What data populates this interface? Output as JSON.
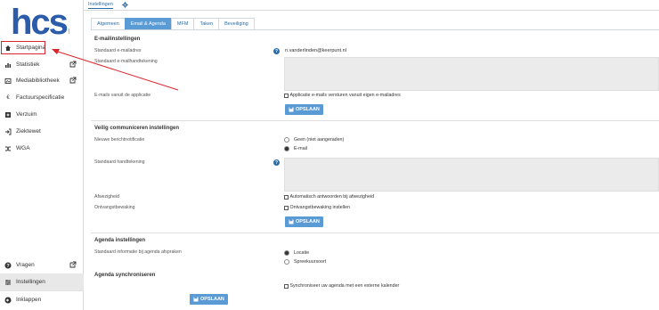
{
  "logo": {
    "text": "hcs."
  },
  "sidebar": {
    "items": [
      {
        "label": "Startpagina",
        "icon": "home-icon"
      },
      {
        "label": "Statistiek",
        "icon": "chart-icon"
      },
      {
        "label": "Mediabibliotheek",
        "icon": "media-icon"
      },
      {
        "label": "Factuurspecificatie",
        "icon": "euro-icon"
      },
      {
        "label": "Verzuim",
        "icon": "plus-square-icon"
      },
      {
        "label": "Ziektewet",
        "icon": "sign-in-icon"
      },
      {
        "label": "WGA",
        "icon": "shuffle-icon"
      }
    ],
    "bottom": [
      {
        "label": "Vragen",
        "icon": "question-icon"
      },
      {
        "label": "Instellingen",
        "icon": "settings-icon"
      },
      {
        "label": "Inklappen",
        "icon": "arrow-left-icon"
      }
    ]
  },
  "topbar": {
    "crumb": "Instellingen"
  },
  "tabs": [
    "Algemeen",
    "Email & Agenda",
    "MFM",
    "Taken",
    "Beveiliging"
  ],
  "email": {
    "title": "E-mailinstellingen",
    "address_label": "Standaard e-mailadres",
    "address_value": "n.vanderlinden@keerpunt.nl",
    "signature_label": "Standaard e-mailhandtekening",
    "from_app_label": "E-mails vanuit de applicatie",
    "from_app_check": "Applicatie e-mails versturen vanuit eigen e-mailadres",
    "save": "OPSLAAN"
  },
  "secure": {
    "title": "Veilig communiceren instellingen",
    "notify_label": "Nieuwe berichtnotificatie",
    "notify_options": [
      "Geen (niet aangeraden)",
      "E-mail"
    ],
    "signature_label": "Standaard handtekening",
    "absence_label": "Afwezigheid",
    "absence_check": "Automatisch antwoorden bij afwezigheid",
    "receipt_label": "Ontvangstbewaking",
    "receipt_check": "Ontvangstbewaking instellen",
    "save": "OPSLAAN"
  },
  "agenda": {
    "title": "Agenda instellingen",
    "info_label": "Standaard informatie bij agenda afspraken",
    "info_options": [
      "Locatie",
      "Spreekuursoort"
    ],
    "sync_title": "Agenda synchroniseren",
    "sync_check": "Synchroniseer uw agenda met een externe kalender",
    "save": "OPSLAAN"
  },
  "colors": {
    "accent": "#5b9bd5",
    "brand": "#2a5caa",
    "annotation": "#d9262c"
  }
}
